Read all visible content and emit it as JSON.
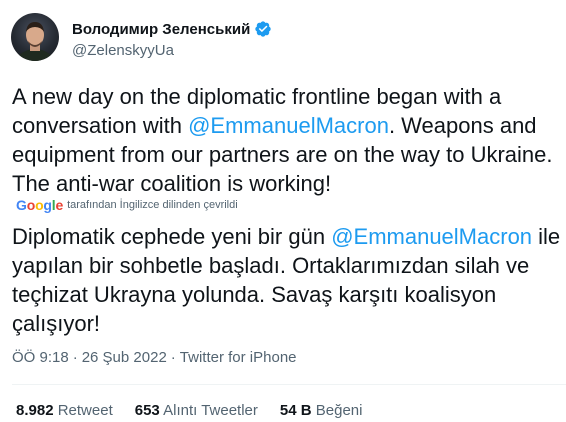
{
  "author": {
    "display_name": "Володимир Зеленський",
    "handle": "@ZelenskyyUa",
    "verified_icon": "verified-badge-icon",
    "verified_color": "#1d9bf0"
  },
  "tweet": {
    "parts": [
      "A new day on the diplomatic frontline began with a conversation with ",
      "@EmmanuelMacron",
      ". Weapons and equipment from our partners are on the way to Ukraine. The anti-war coalition is working!"
    ]
  },
  "translation": {
    "provider": "Google",
    "label": "tarafından İngilizce dilinden çevrildi",
    "parts": [
      "Diplomatik cephede yeni bir gün ",
      "@EmmanuelMacron",
      " ile yapılan bir sohbetle başladı. Ortaklarımızdan silah ve teçhizat Ukrayna yolunda. Savaş karşıtı koalisyon çalışıyor!"
    ]
  },
  "meta": {
    "time": "ÖÖ 9:18",
    "sep1": "·",
    "date": "26 Şub 2022",
    "sep2": "·",
    "source": "Twitter for iPhone"
  },
  "stats": {
    "retweets_num": "8.982",
    "retweets_label": "Retweet",
    "quotes_num": "653",
    "quotes_label": "Alıntı Tweetler",
    "likes_num": "54 B",
    "likes_label": "Beğeni"
  },
  "colors": {
    "link": "#1d9bf0",
    "secondary": "#536471",
    "primary": "#0f1419"
  }
}
